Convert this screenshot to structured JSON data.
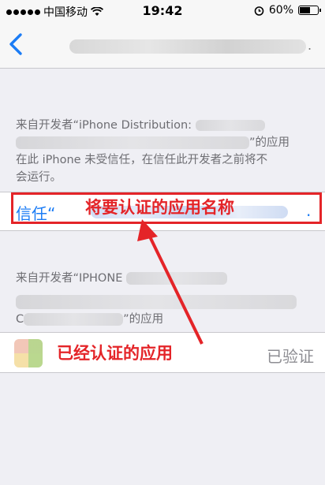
{
  "status_bar": {
    "carrier": "中国移动",
    "time": "19:42",
    "battery_percent": "60%",
    "battery_level": 0.6
  },
  "nav": {
    "title_suffix": "."
  },
  "trusted_developer": {
    "line1": "来自开发者“iPhone Distribution:",
    "line2_suffix": "”的应用",
    "line3": "在此 iPhone 未受信任，在信任此开发者之前将不",
    "line4": "会运行。"
  },
  "trust_action": {
    "label": "信任“",
    "suffix": "."
  },
  "second_developer": {
    "line1": "来自开发者“IPHONE",
    "line3_prefix": "C",
    "line3_suffix": "”的应用"
  },
  "verified_app": {
    "status": "已验证"
  },
  "annotations": {
    "app_name_to_verify": "将要认证的应用名称",
    "verified_app": "已经认证的应用",
    "color": "#e42428"
  },
  "colors": {
    "accent_blue": "#1b7cf5",
    "background": "#efeff4"
  }
}
